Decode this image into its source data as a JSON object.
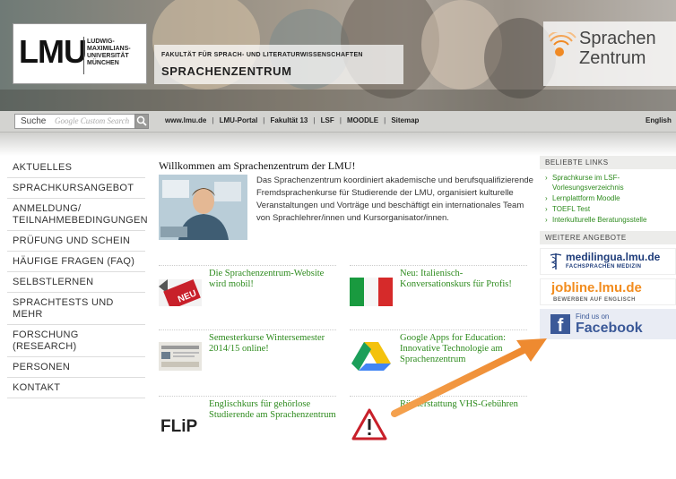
{
  "header": {
    "lmu_logo": "LMU",
    "lmu_name": "LUDWIG-MAXIMILIANS-UNIVERSITÄT MÜNCHEN",
    "faculty": "FAKULTÄT FÜR SPRACH- UND LITERATURWISSENSCHAFTEN",
    "institute": "SPRACHENZENTRUM",
    "sz_logo_line1": "Sprachen",
    "sz_logo_line2": "Zentrum"
  },
  "navbar": {
    "search_label": "Suche",
    "search_placeholder": "Google Custom Search",
    "links": [
      "www.lmu.de",
      "LMU-Portal",
      "Fakultät 13",
      "LSF",
      "MOODLE",
      "Sitemap"
    ],
    "language": "English"
  },
  "sidebar": {
    "items": [
      {
        "label": "Aktuelles"
      },
      {
        "label": "Sprachkursangebot"
      },
      {
        "label": "Anmeldung/ Teilnahmebedingungen"
      },
      {
        "label": "Prüfung und Schein"
      },
      {
        "label": "Häufige Fragen (FAQ)"
      },
      {
        "label": "Selbstlernen"
      },
      {
        "label": "Sprachtests und mehr"
      },
      {
        "label": "Forschung (Research)"
      },
      {
        "label": "Personen"
      },
      {
        "label": "Kontakt"
      }
    ]
  },
  "main": {
    "title": "Willkommen am Sprachenzentrum der LMU!",
    "intro": "Das Sprachenzentrum koordiniert akademische und berufsqualifizierende Fremdsprachenkurse für Studierende der LMU, organisiert kulturelle Veranstaltungen und Vorträge und beschäftigt ein internationales Team von Sprachlehrer/innen und Kursorganisator/innen.",
    "news": [
      {
        "title": "Die Sprachenzentrum-Website wird mobil!",
        "icon": "neu-badge-icon",
        "badge": "NEU"
      },
      {
        "title": "Neu: Italienisch-Konversationskurs für Profis!",
        "icon": "italian-flag-icon"
      },
      {
        "title": "Semesterkurse Wintersemester 2014/15 online!",
        "icon": "course-list-thumbnail"
      },
      {
        "title": "Google Apps for Education: Innovative Technologie am Sprachenzentrum",
        "icon": "google-drive-icon"
      },
      {
        "title": "Englischkurs für gehörlose Studierende am Sprachenzentrum",
        "icon": "flip-logo",
        "logo_text": "FLiP"
      },
      {
        "title": "Rückerstattung VHS-Gebühren",
        "icon": "warning-icon"
      }
    ]
  },
  "right": {
    "popular_heading": "Beliebte Links",
    "popular_links": [
      "Sprachkurse im LSF-Vorlesungsverzeichnis",
      "Lernplattform Moodle",
      "TOEFL Test",
      "Interkulturelle Beratungsstelle"
    ],
    "more_heading": "Weitere Angebote",
    "medilingua": "medilingua.lmu.de",
    "medilingua_sub": "FACHSPRACHEN MEDIZIN",
    "jobline": "jobline.lmu.de",
    "jobline_sub": "BEWERBEN AUF ENGLISCH",
    "facebook_small": "Find us on",
    "facebook_big": "Facebook"
  },
  "colors": {
    "link_green": "#2e8b1e",
    "facebook_blue": "#3b5998",
    "arrow_orange": "#f0943c",
    "jobline_orange": "#f28c1e"
  }
}
